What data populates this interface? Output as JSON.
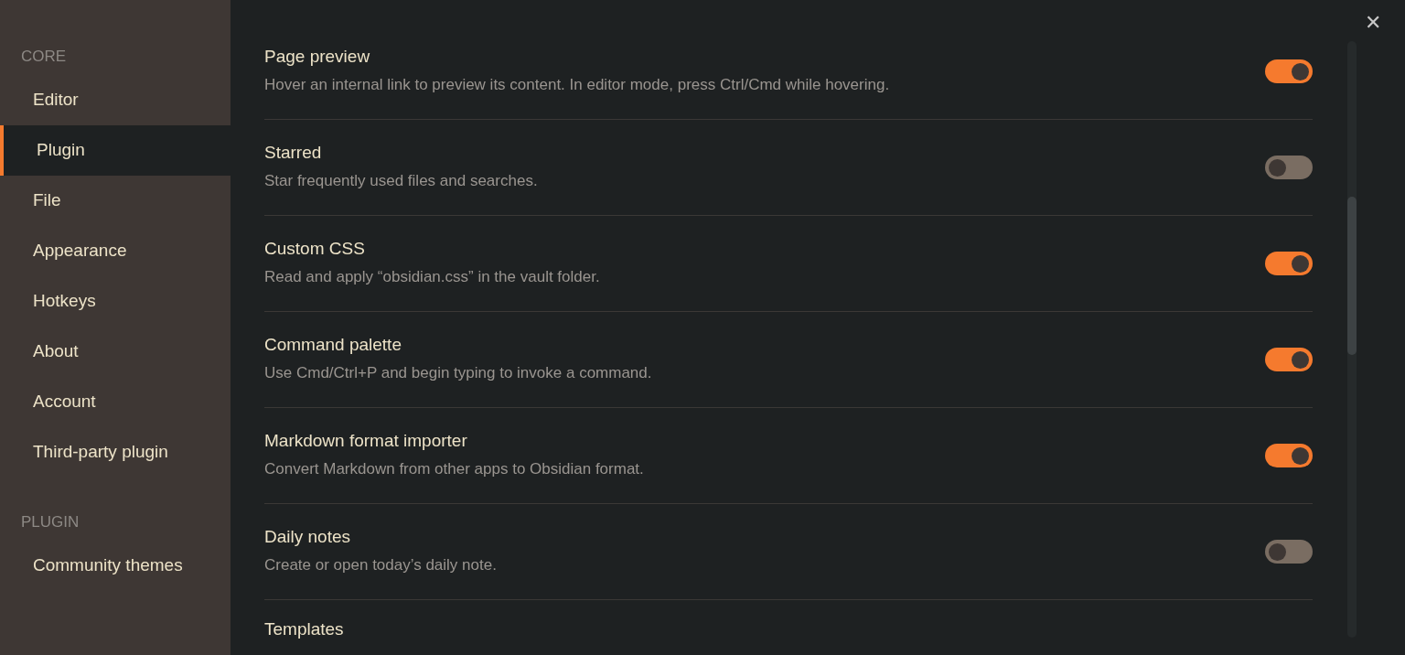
{
  "sidebar": {
    "sections": [
      {
        "heading": "CORE",
        "items": [
          {
            "label": "Editor",
            "selected": false
          },
          {
            "label": "Plugin",
            "selected": true
          },
          {
            "label": "File",
            "selected": false
          },
          {
            "label": "Appearance",
            "selected": false
          },
          {
            "label": "Hotkeys",
            "selected": false
          },
          {
            "label": "About",
            "selected": false
          },
          {
            "label": "Account",
            "selected": false
          },
          {
            "label": "Third-party plugin",
            "selected": false
          }
        ]
      },
      {
        "heading": "PLUGIN",
        "items": [
          {
            "label": "Community themes",
            "selected": false
          }
        ]
      }
    ]
  },
  "close_button": "✕",
  "settings": [
    {
      "title": "Page preview",
      "description": "Hover an internal link to preview its content. In editor mode, press Ctrl/Cmd while hovering.",
      "on": true
    },
    {
      "title": "Starred",
      "description": "Star frequently used files and searches.",
      "on": false
    },
    {
      "title": "Custom CSS",
      "description": "Read and apply “obsidian.css” in the vault folder.",
      "on": true
    },
    {
      "title": "Command palette",
      "description": "Use Cmd/Ctrl+P and begin typing to invoke a command.",
      "on": true
    },
    {
      "title": "Markdown format importer",
      "description": "Convert Markdown from other apps to Obsidian format.",
      "on": true
    },
    {
      "title": "Daily notes",
      "description": "Create or open today’s daily note.",
      "on": false
    },
    {
      "title": "Templates"
    }
  ]
}
